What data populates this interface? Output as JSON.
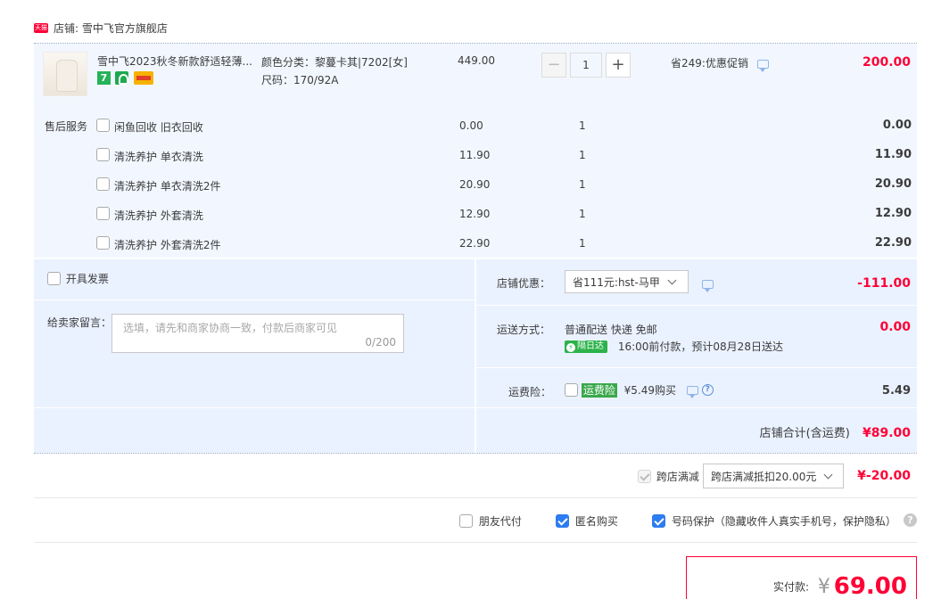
{
  "shop": {
    "logo_text": "天猫",
    "label": "店铺: 雪中飞官方旗舰店"
  },
  "product": {
    "title": "雪中飞2023秋冬新款舒适轻薄...",
    "sku_color": "颜色分类：黎蔓卡其|7202[女]",
    "sku_size": "尺码：170/92A",
    "unit_price": "449.00",
    "quantity": "1",
    "minus": "−",
    "plus": "+",
    "promo": "省249:优惠促销",
    "subtotal": "200.00"
  },
  "after_sales": {
    "label": "售后服务",
    "items": [
      {
        "name": "闲鱼回收 旧衣回收",
        "price": "0.00",
        "qty": "1",
        "amount": "0.00"
      },
      {
        "name": "清洗养护 单衣清洗",
        "price": "11.90",
        "qty": "1",
        "amount": "11.90"
      },
      {
        "name": "清洗养护 单衣清洗2件",
        "price": "20.90",
        "qty": "1",
        "amount": "20.90"
      },
      {
        "name": "清洗养护 外套清洗",
        "price": "12.90",
        "qty": "1",
        "amount": "12.90"
      },
      {
        "name": "清洗养护 外套清洗2件",
        "price": "22.90",
        "qty": "1",
        "amount": "22.90"
      }
    ]
  },
  "invoice": {
    "label": "开具发票"
  },
  "message": {
    "label": "给卖家留言：",
    "placeholder": "选填，请先和商家协商一致，付款后商家可见",
    "count": "0/200"
  },
  "shop_discount": {
    "label": "店铺优惠：",
    "selected": "省111元:hst-马甲",
    "amount": "-111.00"
  },
  "shipping": {
    "label": "运送方式：",
    "method": "普通配送 快递 免邮",
    "tag": "隔日达",
    "eta": "16:00前付款，预计08月28日送达",
    "amount": "0.00"
  },
  "insurance": {
    "label": "运费险：",
    "tag": "运费险",
    "price_text": "¥5.49购买",
    "amount": "5.49"
  },
  "shop_total": {
    "label": "店铺合计(含运费)",
    "amount": "¥89.00"
  },
  "cross_store": {
    "label": "跨店满减",
    "selected": "跨店满减抵扣20.00元",
    "amount": "¥-20.00"
  },
  "options": {
    "friend_pay": "朋友代付",
    "anonymous": "匿名购买",
    "number_protect": "号码保护（隐藏收件人真实手机号，保护隐私）",
    "help": "?"
  },
  "payment": {
    "label": "实付款:",
    "currency": "¥",
    "amount": "69.00"
  },
  "colors": {
    "accent_red": "#ff0036",
    "accent_blue": "#2d7cf0",
    "band": "#f2f7ff"
  }
}
